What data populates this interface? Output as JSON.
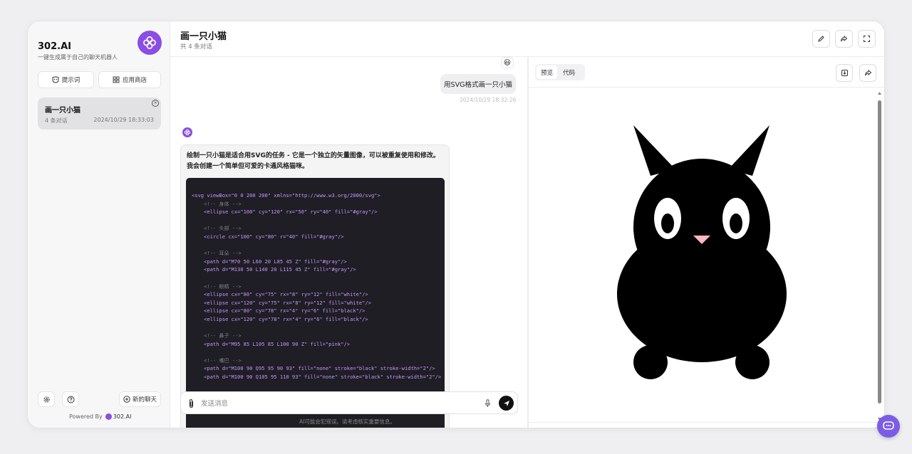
{
  "sidebar": {
    "brand_title": "302.AI",
    "brand_subtitle": "一键生成属于自己的聊天机器人",
    "prompt_button": "提示词",
    "app_store_button": "应用商店",
    "conversation": {
      "title": "画一只小猫",
      "count": "4 条对话",
      "time": "2024/10/29 18:33:03"
    },
    "new_chat_button": "新的聊天",
    "powered_by": "Powered By",
    "powered_brand": "302.AI"
  },
  "header": {
    "title": "画一只小猫",
    "subtitle": "共 4 条对话"
  },
  "chat": {
    "emoji": "😃",
    "user_message": "用SVG格式画一只小猫",
    "user_time": "2024/10/29 18:32:26",
    "bot_text": "绘制一只小猫是适合用SVG的任务 - 它是一个独立的矢量图像，可以被重复使用和修改。我会创建一个简单但可爱的卡通风格猫咪。",
    "code_lines": [
      "<svg viewBox=\"0 0 200 200\" xmlns=\"http://www.w3.org/2000/svg\">",
      "    <!-- 身体 -->",
      "    <ellipse cx=\"100\" cy=\"120\" rx=\"50\" ry=\"40\" fill=\"#gray\"/>",
      "",
      "    <!-- 头部 -->",
      "    <circle cx=\"100\" cy=\"80\" r=\"40\" fill=\"#gray\"/>",
      "",
      "    <!-- 耳朵 -->",
      "    <path d=\"M70 50 L60 20 L85 45 Z\" fill=\"#gray\"/>",
      "    <path d=\"M130 50 L140 20 L115 45 Z\" fill=\"#gray\"/>",
      "",
      "    <!-- 眼睛 -->",
      "    <ellipse cx=\"80\" cy=\"75\" rx=\"8\" ry=\"12\" fill=\"white\"/>",
      "    <ellipse cx=\"120\" cy=\"75\" rx=\"8\" ry=\"12\" fill=\"white\"/>",
      "    <ellipse cx=\"80\" cy=\"78\" rx=\"4\" ry=\"6\" fill=\"black\"/>",
      "    <ellipse cx=\"120\" cy=\"78\" rx=\"4\" ry=\"6\" fill=\"black\"/>",
      "",
      "    <!-- 鼻子 -->",
      "    <path d=\"M95 85 L105 85 L100 90 Z\" fill=\"pink\"/>",
      "",
      "    <!-- 嘴巴 -->",
      "    <path d=\"M100 90 Q95 95 90 93\" fill=\"none\" stroke=\"black\" stroke-width=\"2\"/>",
      "    <path d=\"M100 90 Q105 95 110 93\" fill=\"none\" stroke=\"black\" stroke-width=\"2\"/>"
    ],
    "input_placeholder": "发送消息",
    "disclaimer": "AI可能会犯错误。请考虑核实重要信息。"
  },
  "preview": {
    "tabs": [
      "预览",
      "代码"
    ],
    "active_tab": "预览"
  },
  "colors": {
    "brand_purple": "#8a4de6",
    "fab_purple": "#7b5ce6",
    "code_bg": "#1e1e24",
    "cat_nose": "#ffb6c1"
  }
}
